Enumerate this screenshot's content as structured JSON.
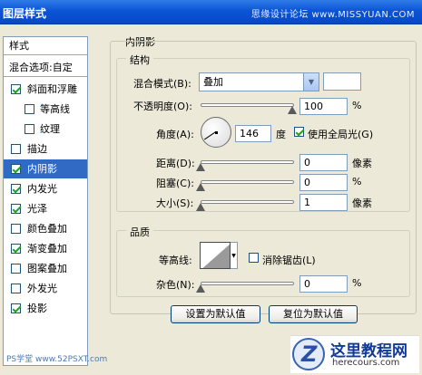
{
  "window": {
    "title": "图层样式",
    "watermark": "思缘设计论坛 www.MISSYUAN.COM"
  },
  "styles_panel": {
    "header": "样式",
    "blend_options": "混合选项:自定",
    "items": [
      {
        "label": "斜面和浮雕",
        "checked": true
      },
      {
        "label": "等高线",
        "checked": false,
        "sub": true
      },
      {
        "label": "纹理",
        "checked": false,
        "sub": true
      },
      {
        "label": "描边",
        "checked": false
      },
      {
        "label": "内阴影",
        "checked": true,
        "selected": true
      },
      {
        "label": "内发光",
        "checked": true
      },
      {
        "label": "光泽",
        "checked": true
      },
      {
        "label": "颜色叠加",
        "checked": false
      },
      {
        "label": "渐变叠加",
        "checked": true
      },
      {
        "label": "图案叠加",
        "checked": false
      },
      {
        "label": "外发光",
        "checked": false
      },
      {
        "label": "投影",
        "checked": true
      }
    ]
  },
  "inner_shadow": {
    "section_title": "内阴影",
    "structure": {
      "title": "结构",
      "blend_mode_label": "混合模式(B):",
      "blend_mode_value": "叠加",
      "opacity_label": "不透明度(O):",
      "opacity_value": "100",
      "opacity_unit": "%",
      "angle_label": "角度(A):",
      "angle_value": "146",
      "angle_unit": "度",
      "global_light_label": "使用全局光(G)",
      "global_light_checked": true,
      "distance_label": "距离(D):",
      "distance_value": "0",
      "distance_unit": "像素",
      "choke_label": "阻塞(C):",
      "choke_value": "0",
      "choke_unit": "%",
      "size_label": "大小(S):",
      "size_value": "1",
      "size_unit": "像素"
    },
    "quality": {
      "title": "品质",
      "contour_label": "等高线:",
      "anti_alias_label": "消除锯齿(L)",
      "anti_alias_checked": false,
      "noise_label": "杂色(N):",
      "noise_value": "0",
      "noise_unit": "%"
    },
    "buttons": {
      "set_default": "设置为默认值",
      "reset_default": "复位为默认值"
    }
  },
  "watermarks": {
    "site_cn": "这里教程网",
    "site_en": "herecours.com",
    "ps_tag": "PS学堂 www.52PSXT.com"
  }
}
